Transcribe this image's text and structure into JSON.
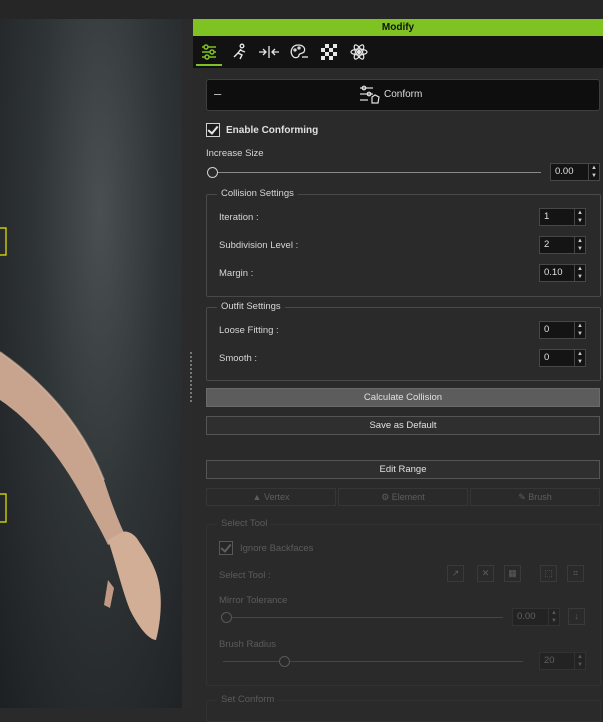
{
  "panel": {
    "title": "Modify"
  },
  "tabs": [
    {
      "icon": "sliders-icon"
    },
    {
      "icon": "pose-runner-icon"
    },
    {
      "icon": "morph-arrows-icon"
    },
    {
      "icon": "palette-icon"
    },
    {
      "icon": "checker-texture-icon"
    },
    {
      "icon": "atom-physics-icon"
    }
  ],
  "conform_section": {
    "label": "Conform",
    "collapse_symbol": "–"
  },
  "enable_conforming": {
    "label": "Enable Conforming",
    "checked": true
  },
  "increase_size": {
    "label": "Increase Size",
    "value": "0.00"
  },
  "collision_settings": {
    "title": "Collision Settings",
    "iteration": {
      "label": "Iteration :",
      "value": "1"
    },
    "subdivision": {
      "label": "Subdivision Level :",
      "value": "2"
    },
    "margin": {
      "label": "Margin :",
      "value": "0.10"
    }
  },
  "outfit_settings": {
    "title": "Outfit Settings",
    "loose_fitting": {
      "label": "Loose Fitting :",
      "value": "0"
    },
    "smooth": {
      "label": "Smooth :",
      "value": "0"
    }
  },
  "buttons": {
    "calculate_collision": "Calculate Collision",
    "save_default": "Save as Default",
    "edit_range": "Edit Range"
  },
  "modes": {
    "vertex": "Vertex",
    "element": "Element",
    "brush": "Brush"
  },
  "mode_icons": {
    "vertex": "▲",
    "element": "⚙",
    "brush": "✎"
  },
  "select_tool_group": {
    "title": "Select Tool",
    "ignore_backfaces": "Ignore Backfaces",
    "select_tool_label": "Select Tool :",
    "mirror_tolerance": {
      "label": "Mirror Tolerance",
      "value": "0.00"
    },
    "brush_radius": {
      "label": "Brush Radius",
      "value": "20"
    }
  },
  "set_conform": {
    "title": "Set Conform"
  },
  "colors": {
    "accent": "#7ec321",
    "panel_bg": "#2a2a2a"
  }
}
